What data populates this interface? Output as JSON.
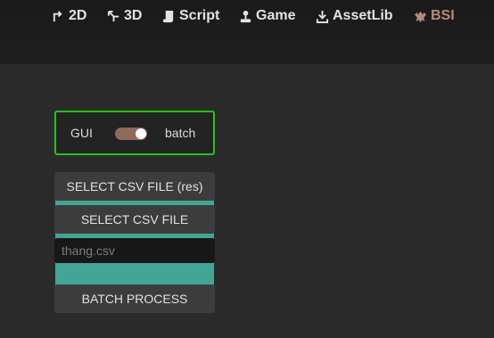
{
  "toolbar": {
    "tabs": [
      {
        "label": "2D",
        "icon": "2d-arrow-icon"
      },
      {
        "label": "3D",
        "icon": "3d-axes-icon"
      },
      {
        "label": "Script",
        "icon": "script-icon"
      },
      {
        "label": "Game",
        "icon": "joystick-icon"
      },
      {
        "label": "AssetLib",
        "icon": "download-icon"
      },
      {
        "label": "BSI",
        "icon": "bsi-plugin-icon"
      }
    ],
    "active_tab": "BSI",
    "active_color": "#b9897a"
  },
  "mode": {
    "left_label": "GUI",
    "right_label": "batch",
    "selected": "batch",
    "border_color": "#27c21f",
    "toggle_color": "#8d6a5a"
  },
  "buttons": {
    "select_csv_res": "SELECT CSV FILE (res)",
    "select_csv": "SELECT CSV FILE",
    "batch_process": "BATCH PROCESS"
  },
  "file_field": {
    "value": "",
    "placeholder": "thang.csv"
  },
  "colors": {
    "background": "#2b2b2b",
    "panel_accent": "#44a596"
  }
}
